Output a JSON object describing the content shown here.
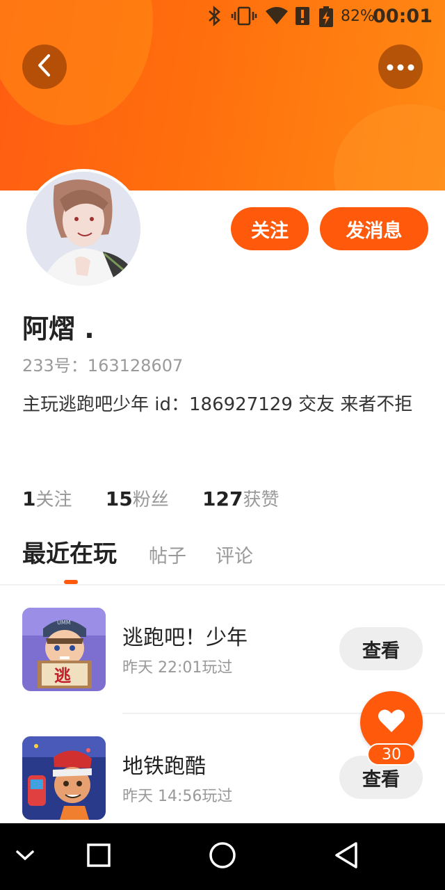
{
  "status_bar": {
    "battery": "82%",
    "time": "00:01",
    "icons": [
      "bluetooth-icon",
      "vibrate-icon",
      "wifi-icon",
      "alert-icon",
      "battery-charging-icon"
    ]
  },
  "header": {
    "back_icon": "chevron-left-icon",
    "more_icon": "more-dots-icon",
    "accent_color": "#ff5a0c"
  },
  "profile": {
    "follow_label": "关注",
    "message_label": "发消息",
    "username": "阿熠 .",
    "user_id": "233号：163128607",
    "bio": "主玩逃跑吧少年 id：186927129 交友 来者不拒"
  },
  "stats": [
    {
      "count": "1",
      "label": "关注"
    },
    {
      "count": "15",
      "label": "粉丝"
    },
    {
      "count": "127",
      "label": "获赞"
    }
  ],
  "tabs": [
    {
      "label": "最近在玩",
      "active": true
    },
    {
      "label": "帖子",
      "active": false
    },
    {
      "label": "评论",
      "active": false
    }
  ],
  "games": [
    {
      "title": "逃跑吧！少年",
      "played": "昨天 22:01玩过",
      "button": "查看"
    },
    {
      "title": "地铁跑酷",
      "played": "昨天 14:56玩过",
      "button": "查看"
    }
  ],
  "like_fab": {
    "count": "30"
  }
}
